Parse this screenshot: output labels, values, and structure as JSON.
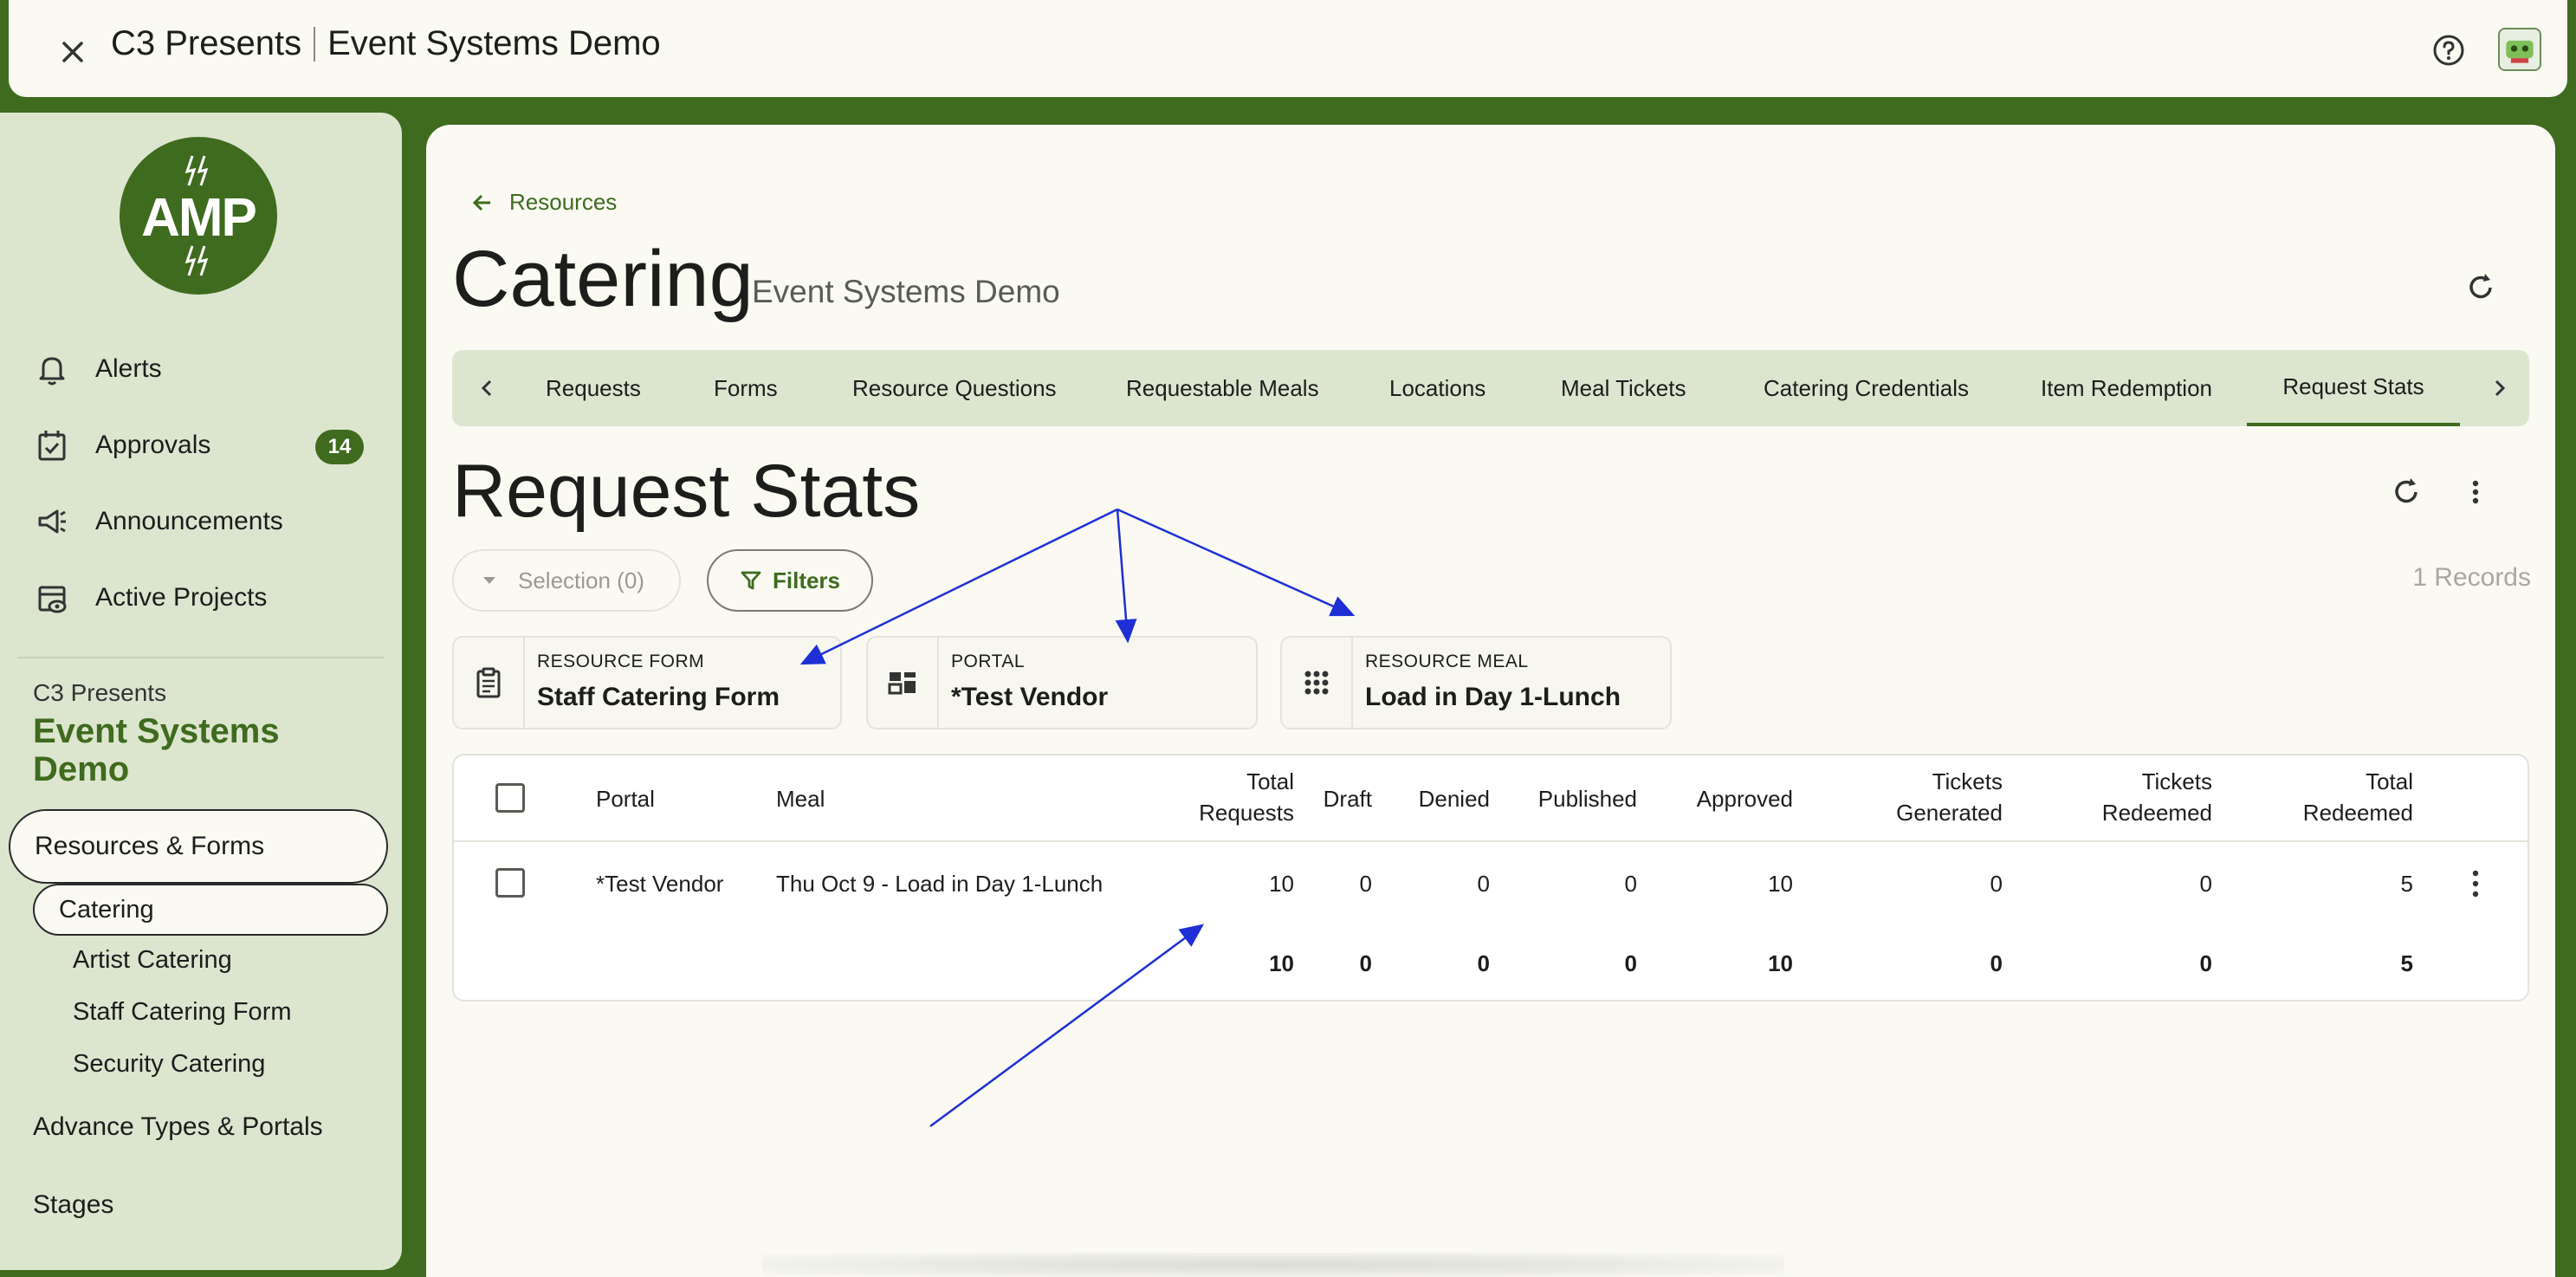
{
  "topbar": {
    "org": "C3 Presents",
    "project": "Event Systems Demo"
  },
  "sidebar": {
    "logo_text": "AMP",
    "nav": [
      {
        "label": "Alerts"
      },
      {
        "label": "Approvals",
        "badge": "14"
      },
      {
        "label": "Announcements"
      },
      {
        "label": "Active Projects"
      }
    ],
    "org": "C3 Presents",
    "project": "Event Systems Demo",
    "resources_forms": "Resources & Forms",
    "sub_items": [
      "Catering",
      "Artist Catering",
      "Staff Catering Form",
      "Security Catering"
    ],
    "advance_types": "Advance Types & Portals",
    "stages": "Stages"
  },
  "main": {
    "back_label": "Resources",
    "title": "Catering",
    "subtitle": "Event Systems Demo",
    "tabs": [
      "Requests",
      "Forms",
      "Resource Questions",
      "Requestable Meals",
      "Locations",
      "Meal Tickets",
      "Catering Credentials",
      "Item Redemption",
      "Request Stats"
    ],
    "active_tab": "Request Stats",
    "section_title": "Request Stats",
    "selection_label": "Selection (0)",
    "filters_label": "Filters",
    "records_label": "1 Records",
    "chips": [
      {
        "label": "RESOURCE FORM",
        "value": "Staff Catering Form",
        "icon": "clipboard-icon"
      },
      {
        "label": "PORTAL",
        "value": "*Test Vendor",
        "icon": "dashboard-icon"
      },
      {
        "label": "RESOURCE MEAL",
        "value": "Load in Day 1-Lunch",
        "icon": "grid-dots-icon"
      }
    ]
  },
  "table": {
    "headers": {
      "portal": "Portal",
      "meal": "Meal",
      "total_requests_1": "Total",
      "total_requests_2": "Requests",
      "draft": "Draft",
      "denied": "Denied",
      "published": "Published",
      "approved": "Approved",
      "tickets_generated_1": "Tickets",
      "tickets_generated_2": "Generated",
      "tickets_redeemed_1": "Tickets",
      "tickets_redeemed_2": "Redeemed",
      "total_redeemed_1": "Total",
      "total_redeemed_2": "Redeemed"
    },
    "row": {
      "portal": "*Test Vendor",
      "meal": "Thu Oct 9 - Load in Day 1-Lunch",
      "total_requests": "10",
      "draft": "0",
      "denied": "0",
      "published": "0",
      "approved": "10",
      "tickets_generated": "0",
      "tickets_redeemed": "0",
      "total_redeemed": "5"
    },
    "totals": {
      "total_requests": "10",
      "draft": "0",
      "denied": "0",
      "published": "0",
      "approved": "10",
      "tickets_generated": "0",
      "tickets_redeemed": "0",
      "total_redeemed": "5"
    }
  },
  "colors": {
    "brand_green": "#3e6b1e",
    "sidebar_bg": "#dce6cf",
    "page_bg": "#fafaf3",
    "annotation_blue": "#1f2fd6"
  }
}
